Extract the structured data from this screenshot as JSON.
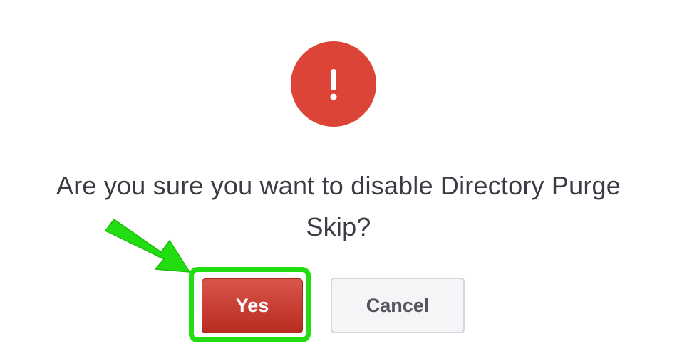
{
  "dialog": {
    "icon": "exclamation-icon",
    "message": "Are you sure you want to disable Directory Purge Skip?",
    "confirm_label": "Yes",
    "cancel_label": "Cancel"
  },
  "annotation": {
    "arrow_icon": "pointer-arrow-icon",
    "highlight_color": "#22dd11"
  },
  "colors": {
    "alert": "#db4437",
    "confirm": "#c4352b",
    "cancel_bg": "#f5f5f8",
    "text": "#3b3b45"
  }
}
